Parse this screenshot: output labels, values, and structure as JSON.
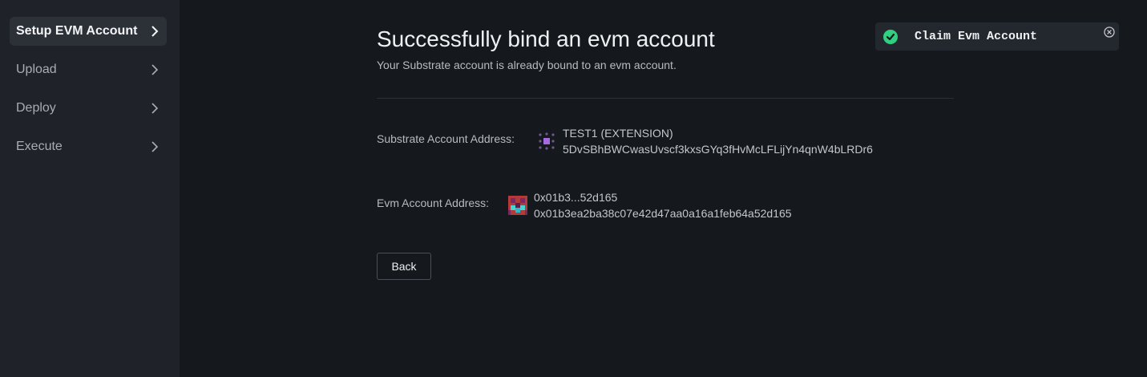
{
  "sidebar": {
    "items": [
      {
        "label": "Setup EVM Account",
        "active": true
      },
      {
        "label": "Upload",
        "active": false
      },
      {
        "label": "Deploy",
        "active": false
      },
      {
        "label": "Execute",
        "active": false
      }
    ]
  },
  "main": {
    "title": "Successfully bind an evm account",
    "subtitle": "Your Substrate account is already bound to an evm account.",
    "substrate": {
      "label": "Substrate Account Address:",
      "name": "TEST1 (EXTENSION)",
      "address": "5DvSBhBWCwasUvscf3kxsGYq3fHvMcLFLijYn4qnW4bLRDr6"
    },
    "evm": {
      "label": "Evm Account Address:",
      "short": "0x01b3...52d165",
      "address": "0x01b3ea2ba38c07e42d47aa0a16a1feb64a52d165"
    },
    "back_label": "Back"
  },
  "toast": {
    "text": "Claim Evm Account",
    "status_color": "#2fd07f"
  },
  "icons": {
    "nav": "chevron-right-icon",
    "toast": "check-circle-icon",
    "close": "close-circle-icon"
  }
}
